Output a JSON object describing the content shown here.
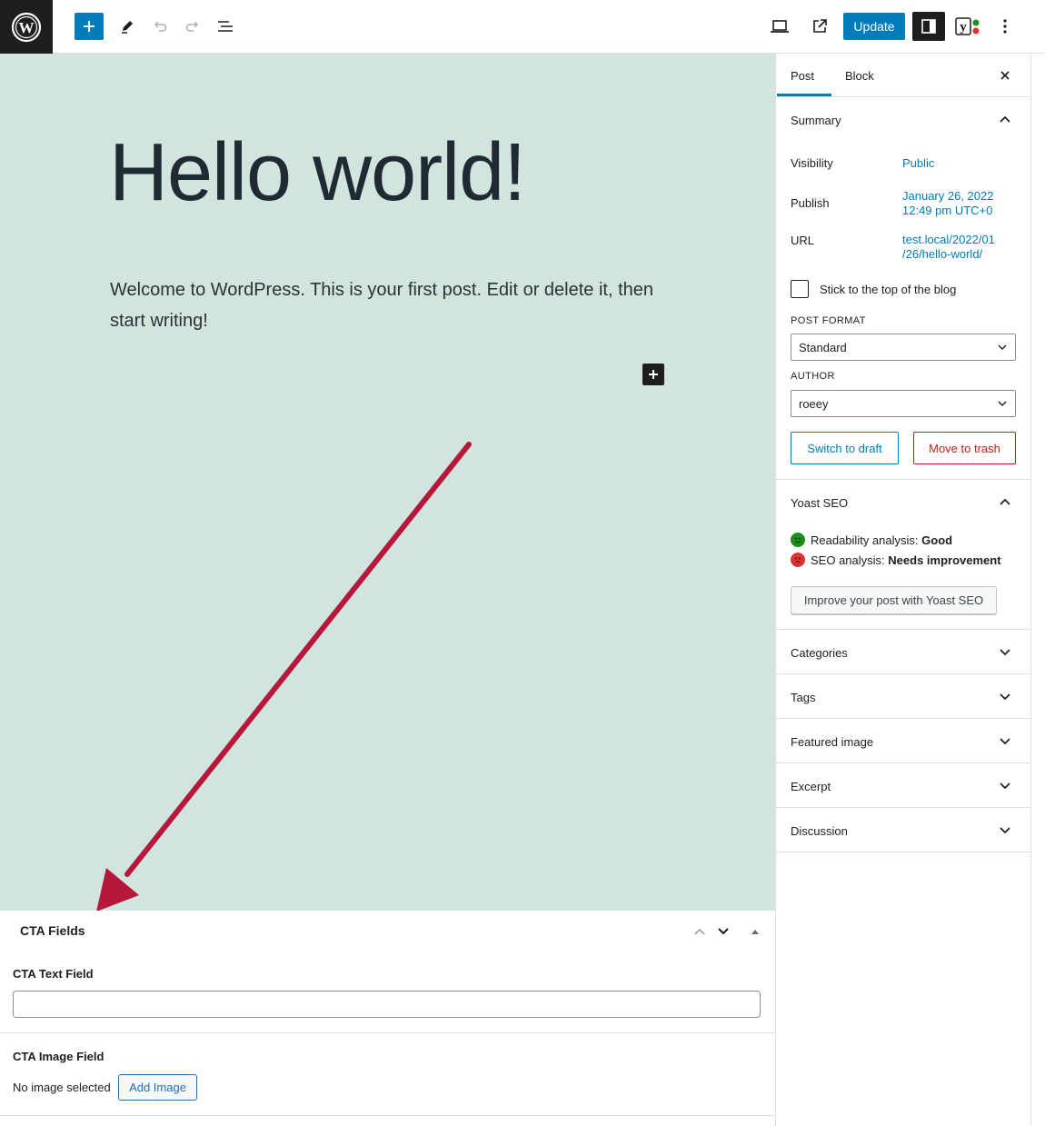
{
  "topbar": {
    "wp_logo": "wordpress-logo",
    "update_label": "Update",
    "yoast_letter": "y"
  },
  "editor": {
    "title": "Hello world!",
    "paragraph": "Welcome to WordPress. This is your first post. Edit or delete it, then start writing!"
  },
  "metabox": {
    "title": "CTA Fields",
    "text_field_label": "CTA Text Field",
    "text_field_value": "",
    "image_field_label": "CTA Image Field",
    "no_image_text": "No image selected",
    "add_image_label": "Add Image"
  },
  "sidebar": {
    "tabs": [
      {
        "label": "Post",
        "active": true
      },
      {
        "label": "Block",
        "active": false
      }
    ],
    "summary": {
      "title": "Summary",
      "visibility_label": "Visibility",
      "visibility_value": "Public",
      "publish_label": "Publish",
      "publish_value_line1": "January 26, 2022",
      "publish_value_line2": "12:49 pm UTC+0",
      "url_label": "URL",
      "url_value_line1": "test.local/2022/01",
      "url_value_line2": "/26/hello-world/",
      "sticky_label": "Stick to the top of the blog",
      "sticky_checked": false,
      "post_format_label": "POST FORMAT",
      "post_format_value": "Standard",
      "author_label": "AUTHOR",
      "author_value": "roeey",
      "switch_draft_label": "Switch to draft",
      "move_trash_label": "Move to trash"
    },
    "yoast": {
      "title": "Yoast SEO",
      "readability_label": "Readability analysis: ",
      "readability_value": "Good",
      "seo_label": "SEO analysis: ",
      "seo_value": "Needs improvement",
      "improve_button": "Improve your post with Yoast SEO"
    },
    "panels": [
      {
        "label": "Categories"
      },
      {
        "label": "Tags"
      },
      {
        "label": "Featured image"
      },
      {
        "label": "Excerpt"
      },
      {
        "label": "Discussion"
      }
    ]
  },
  "colors": {
    "accent": "#007cba",
    "canvas_bg": "#d2e4de",
    "danger": "#cc1818",
    "annotation_arrow": "#b5183a",
    "good": "#1e8c1e",
    "bad": "#dc3232"
  }
}
